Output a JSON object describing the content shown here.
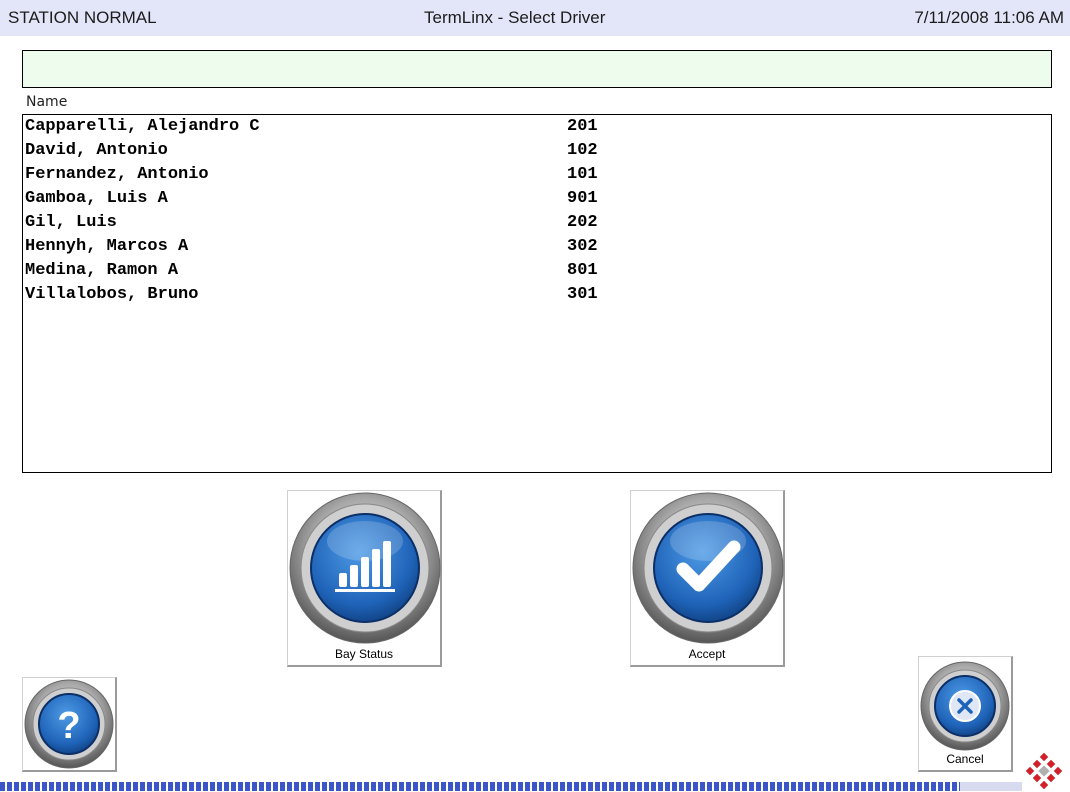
{
  "header": {
    "status": "STATION NORMAL",
    "title": "TermLinx - Select Driver",
    "datetime": "7/11/2008 11:06 AM"
  },
  "search": {
    "value": "",
    "placeholder": ""
  },
  "list": {
    "column_header": "Name",
    "rows": [
      {
        "name": "Capparelli, Alejandro C",
        "number": "201"
      },
      {
        "name": "David, Antonio",
        "number": "102"
      },
      {
        "name": "Fernandez, Antonio",
        "number": "101"
      },
      {
        "name": "Gamboa, Luis A",
        "number": "901"
      },
      {
        "name": "Gil, Luis",
        "number": "202"
      },
      {
        "name": "Hennyh, Marcos A",
        "number": "302"
      },
      {
        "name": "Medina, Ramon A",
        "number": "801"
      },
      {
        "name": "Villalobos, Bruno",
        "number": "301"
      }
    ]
  },
  "buttons": {
    "bay_status": {
      "label": "Bay Status",
      "icon": "bar-chart-icon"
    },
    "accept": {
      "label": "Accept",
      "icon": "checkmark-icon"
    },
    "help": {
      "icon": "question-icon"
    },
    "cancel": {
      "label": "Cancel",
      "icon": "close-circle-icon"
    }
  },
  "colors": {
    "header_bg": "#e3e6f8",
    "input_bg": "#eefcee",
    "button_blue": "#1f63b8",
    "strip_blue": "#3a56c9",
    "logo_red": "#d0202a"
  }
}
